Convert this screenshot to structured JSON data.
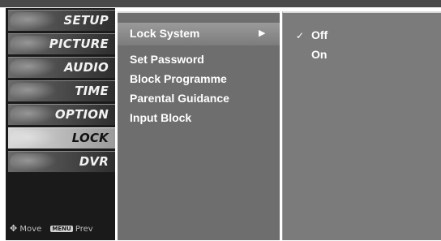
{
  "categories": [
    {
      "label": "SETUP",
      "icon": "satellite-dish-icon"
    },
    {
      "label": "PICTURE",
      "icon": "film-icon"
    },
    {
      "label": "AUDIO",
      "icon": "speaker-icon"
    },
    {
      "label": "TIME",
      "icon": "clock-icon"
    },
    {
      "label": "OPTION",
      "icon": "option-tag-icon"
    },
    {
      "label": "LOCK",
      "icon": "lock-icon",
      "selected": true
    },
    {
      "label": "DVR",
      "icon": "disc-icon"
    }
  ],
  "footer": {
    "move_label": "Move",
    "menu_key": "MENU",
    "prev_label": "Prev"
  },
  "submenu": {
    "items": [
      {
        "label": "Lock System",
        "highlighted": true
      },
      {
        "label": "Set Password"
      },
      {
        "label": "Block Programme"
      },
      {
        "label": "Parental Guidance"
      },
      {
        "label": "Input Block"
      }
    ]
  },
  "options": [
    {
      "label": "Off",
      "checked": true
    },
    {
      "label": "On",
      "checked": false
    }
  ],
  "colors": {
    "panel_dark": "#1a1a1a",
    "submenu_bg": "#6e6e6e",
    "options_bg": "#7b7b7b",
    "text": "#ffffff"
  }
}
